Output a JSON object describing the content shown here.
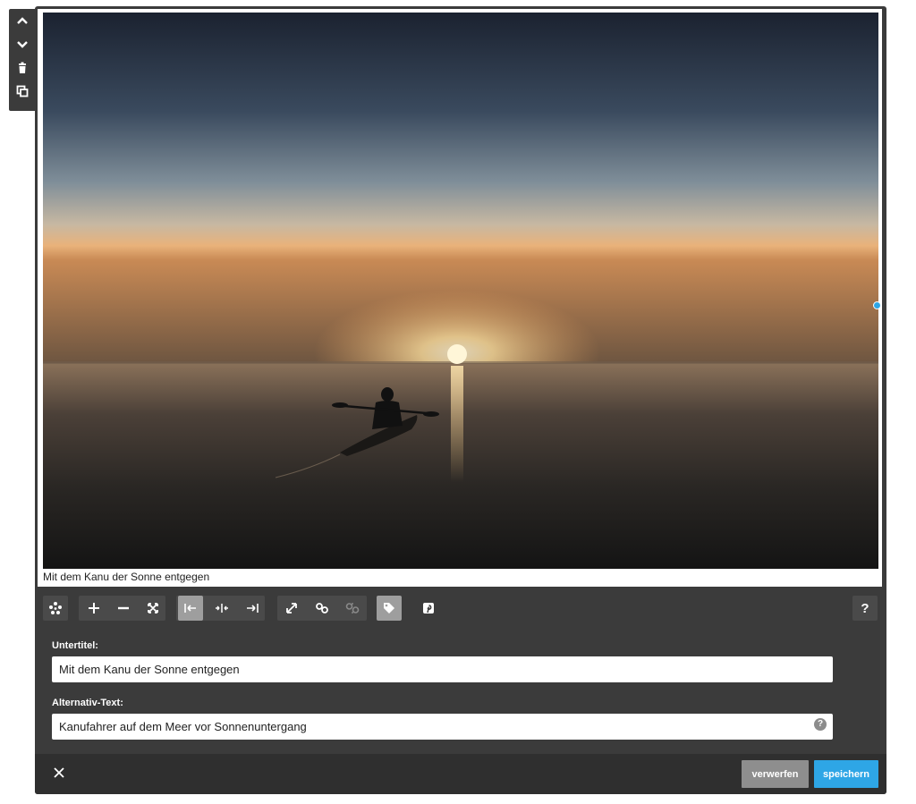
{
  "image": {
    "caption": "Mit dem Kanu der Sonne entgegen"
  },
  "side_tools": [
    "chevron-up-icon",
    "chevron-down-icon",
    "trash-icon",
    "duplicate-icon"
  ],
  "toolbar": {
    "icons": [
      "pinwheel-icon",
      "zoom-in-icon",
      "zoom-out-icon",
      "fit-icon",
      "align-left-icon",
      "align-center-icon",
      "align-right-icon",
      "resize-icon",
      "link-icon",
      "unlink-icon",
      "tag-icon",
      "pinterest-icon"
    ],
    "help": "?"
  },
  "form": {
    "subtitle_label": "Untertitel:",
    "subtitle_value": "Mit dem Kanu der Sonne entgegen",
    "alt_label": "Alternativ-Text:",
    "alt_value": "Kanufahrer auf dem Meer vor Sonnenuntergang",
    "alt_help": "?"
  },
  "footer": {
    "discard_label": "verwerfen",
    "save_label": "speichern"
  },
  "colors": {
    "panel": "#3b3b3b",
    "accent": "#2ea6e6",
    "discard": "#8e8e8e"
  }
}
